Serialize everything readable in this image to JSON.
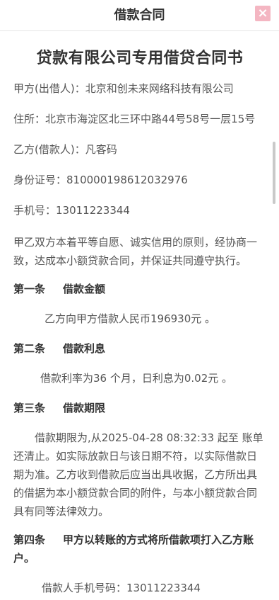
{
  "header": {
    "title": "借款合同",
    "close_label": "×"
  },
  "doc": {
    "title": "贷款有限公司专用借贷合同书",
    "lender": "甲方(出借人)：北京和创未来网络科技有限公司",
    "address": "住所：北京市海淀区北三环中路44号58号一层15号",
    "borrower": "乙方(借款人)：凡客码",
    "id_number": "身份证号：810000198612032976",
    "phone": "手机号：13011223344",
    "intro": "甲乙双方本着平等自愿、诚实信用的原则，经协商一致，达成本小额贷款合同，并保证共同遵守执行。",
    "sections": [
      {
        "num": "第一条",
        "title": "借款金额",
        "body": "乙方向甲方借款人民币196930元 。"
      },
      {
        "num": "第二条",
        "title": "借款利息",
        "body": "借款利率为36 个月，日利息为0.02元 。"
      },
      {
        "num": "第三条",
        "title": "借款期限",
        "body": "借款期限为,从2025-04-28 08:32:33 起至 账单还清止。如实际放款日与该日期不符，以实际借款日期为准。乙方收到借款后应当出具收据，乙方所出具的借据为本小额贷款合同的附件，与本小额贷款合同具有同等法律效力。"
      },
      {
        "num": "第四条",
        "title": "甲方以转账的方式将所借款项打入乙方账户。",
        "body": "借款人手机号码：13011223344"
      }
    ]
  }
}
